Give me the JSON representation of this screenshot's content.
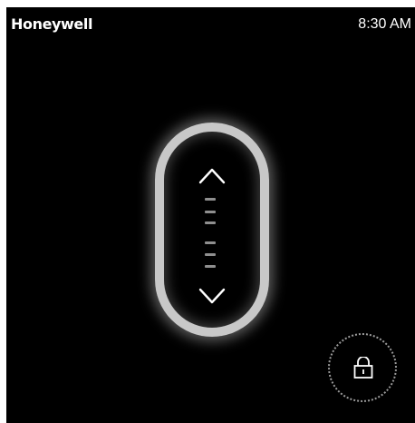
{
  "header": {
    "brand": "Honeywell",
    "time": "8:30 AM"
  },
  "controls": {
    "increase_icon": "chevron-up-icon",
    "decrease_icon": "chevron-down-icon",
    "lock_icon": "unlock-icon"
  },
  "colors": {
    "background": "#000000",
    "ring": "#c8c8c8",
    "text": "#ffffff",
    "tick": "#8f8f8f"
  }
}
